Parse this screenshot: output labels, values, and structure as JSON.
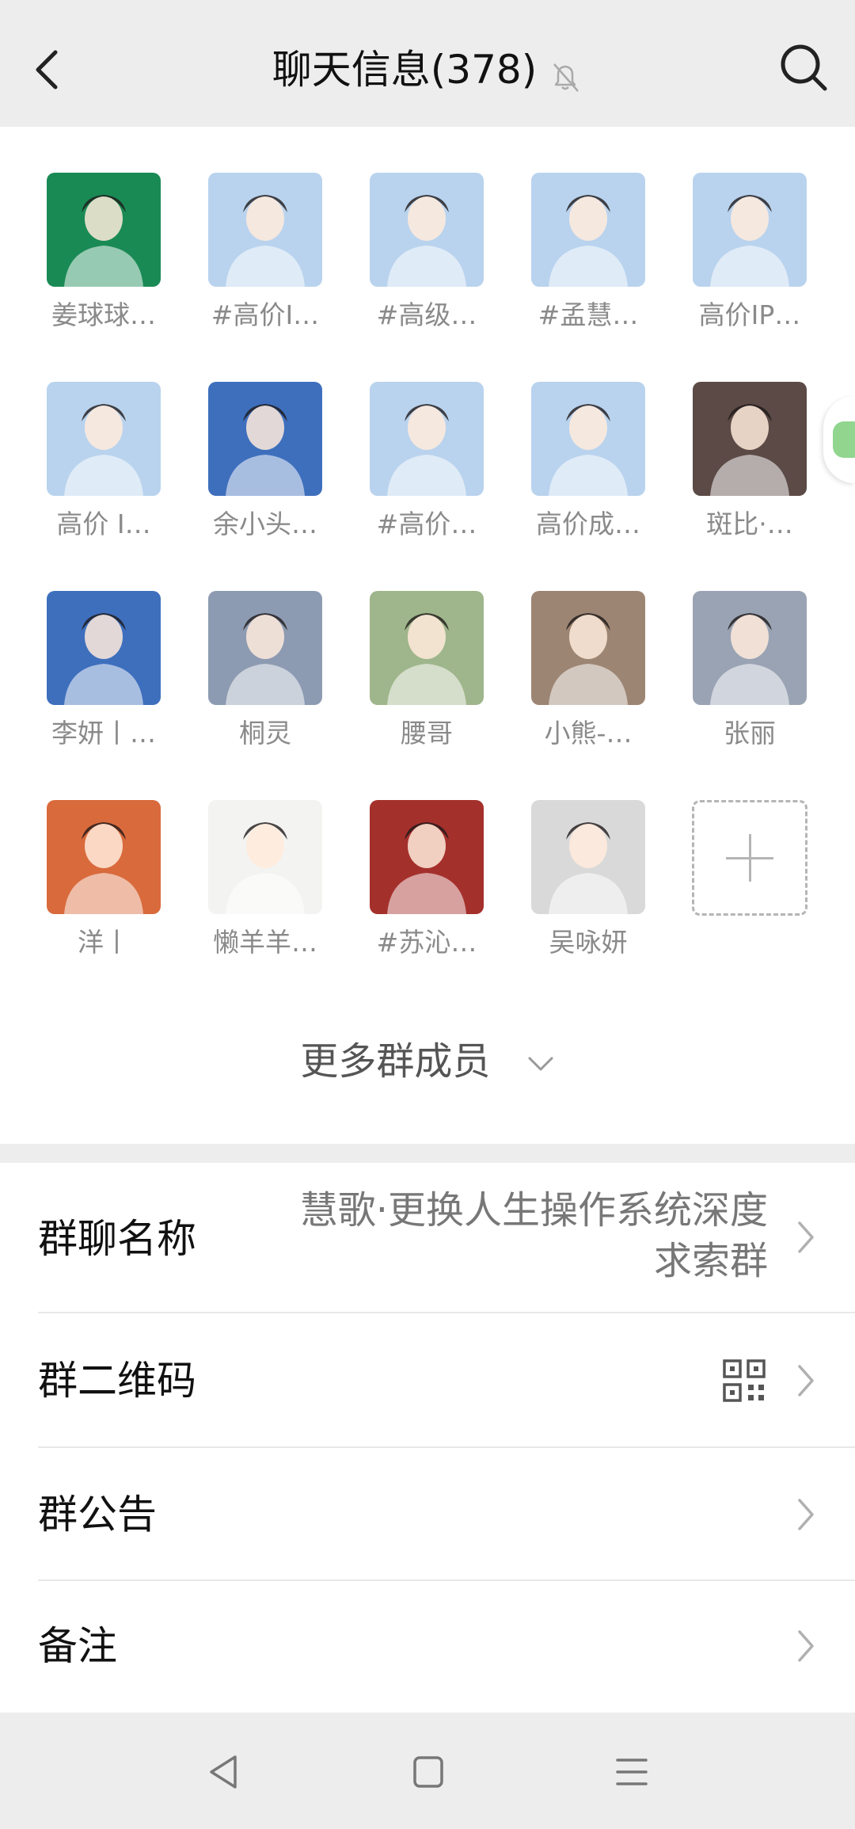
{
  "header": {
    "title": "聊天信息(378)",
    "back_icon": "chevron-left-icon",
    "search_icon": "search-icon",
    "mute_icon": "bell-off-icon"
  },
  "members": [
    {
      "name": "姜球球…",
      "avatar_bg": "#1a8a55"
    },
    {
      "name": "#高价I…",
      "avatar_bg": "#b9d3ee"
    },
    {
      "name": "#高级…",
      "avatar_bg": "#b9d3ee"
    },
    {
      "name": "#孟慧…",
      "avatar_bg": "#b9d3ee"
    },
    {
      "name": "高价IP…",
      "avatar_bg": "#b9d3ee"
    },
    {
      "name": "高价 I…",
      "avatar_bg": "#b9d3ee"
    },
    {
      "name": "余小头…",
      "avatar_bg": "#3e6fbd"
    },
    {
      "name": "#高价…",
      "avatar_bg": "#b9d3ee"
    },
    {
      "name": "高价成…",
      "avatar_bg": "#b9d3ee"
    },
    {
      "name": "斑比·…",
      "avatar_bg": "#5b4a46"
    },
    {
      "name": "李妍丨…",
      "avatar_bg": "#3e6fbd"
    },
    {
      "name": "桐灵",
      "avatar_bg": "#8d9bb2"
    },
    {
      "name": "腰哥",
      "avatar_bg": "#9fb58b"
    },
    {
      "name": "小熊-…",
      "avatar_bg": "#9d8573"
    },
    {
      "name": "张丽",
      "avatar_bg": "#9aa3b3"
    },
    {
      "name": "洋丨",
      "avatar_bg": "#d96a3c"
    },
    {
      "name": "懒羊羊…",
      "avatar_bg": "#f3f3f1"
    },
    {
      "name": "#苏沁…",
      "avatar_bg": "#a4302c"
    },
    {
      "name": "吴咏妍",
      "avatar_bg": "#d9d9d9"
    }
  ],
  "more_members_label": "更多群成员",
  "settings": {
    "group_name_label": "群聊名称",
    "group_name_value_line1": "慧歌·更换人生操作系统深度",
    "group_name_value_line2": "求索群",
    "qr_label": "群二维码",
    "announcement_label": "群公告",
    "remark_label": "备注"
  },
  "colors": {
    "background": "#ededed",
    "panel": "#ffffff",
    "muted_text": "#8a8a8a"
  }
}
